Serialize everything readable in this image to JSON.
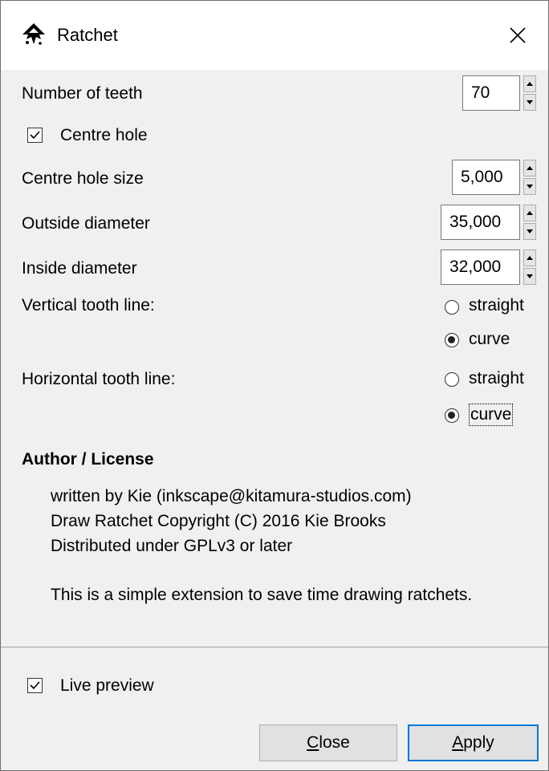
{
  "window": {
    "title": "Ratchet",
    "icon": "inkscape-icon"
  },
  "fields": {
    "teeth_label": "Number of teeth",
    "teeth_value": "70",
    "centre_hole_label": "Centre hole",
    "centre_hole_checked": true,
    "hole_size_label": "Centre hole size",
    "hole_size_value": "5,000",
    "outside_label": "Outside diameter",
    "outside_value": "35,000",
    "inside_label": "Inside diameter",
    "inside_value": "32,000"
  },
  "vertical": {
    "label": "Vertical tooth line:",
    "opt1": "straight",
    "opt2": "curve",
    "selected": "curve"
  },
  "horizontal": {
    "label": "Horizontal tooth line:",
    "opt1": "straight",
    "opt2": "curve",
    "selected": "curve"
  },
  "author": {
    "title": "Author / License",
    "line1": "written by Kie (inkscape@kitamura-studios.com)",
    "line2": "Draw Ratchet Copyright (C) 2016 Kie Brooks",
    "line3": "Distributed under GPLv3 or later",
    "line4": "This is a simple extension to save time drawing ratchets."
  },
  "live_preview": {
    "label": "Live preview",
    "checked": true
  },
  "buttons": {
    "close_mnemonic": "C",
    "close_rest": "lose",
    "apply_mnemonic": "A",
    "apply_rest": "pply"
  }
}
